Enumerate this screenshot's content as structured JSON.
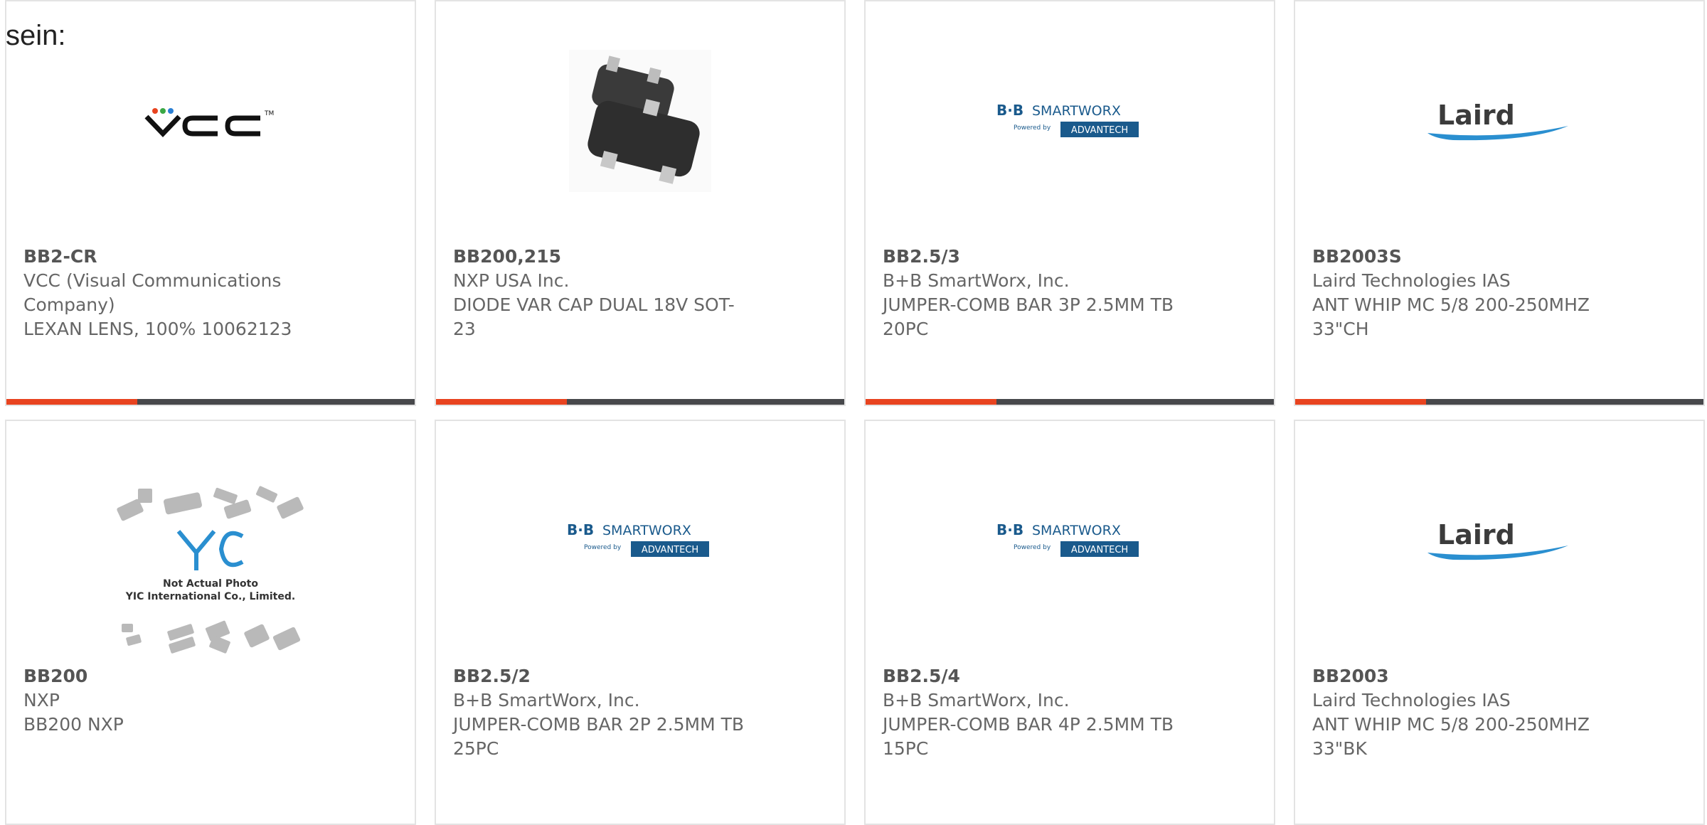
{
  "page": {
    "heading": "sein:"
  },
  "colors": {
    "accent": "#e8431f",
    "bar": "#47484b",
    "border": "#e3e3e3",
    "text": "#666666",
    "brand_blue": "#1a5a8c"
  },
  "products": [
    {
      "part": "BB2-CR",
      "maker": "VCC (Visual Communications Company)",
      "description": "LEXAN LENS, 100% 10062123",
      "logo": "vcc-logo",
      "logo_text": "VCC",
      "progress": 0.32
    },
    {
      "part": "BB200,215",
      "maker": "NXP USA Inc.",
      "description": "DIODE VAR CAP DUAL 18V SOT-23",
      "logo": "sot23-package-photo",
      "progress": 0.32
    },
    {
      "part": "BB2.5/3",
      "maker": "B+B SmartWorx, Inc.",
      "description": "JUMPER-COMB BAR 3P 2.5MM TB 20PC",
      "logo": "bb-smartworx-logo",
      "logo_text": "B+B SMARTWORX",
      "logo_subtext": "Powered by",
      "logo_badge": "ADVANTECH",
      "progress": 0.32
    },
    {
      "part": "BB2003S",
      "maker": "Laird Technologies IAS",
      "description": "ANT WHIP MC 5/8 200-250MHZ 33\"CH",
      "logo": "laird-logo",
      "logo_text": "Laird",
      "progress": 0.32
    },
    {
      "part": "BB200",
      "maker": "NXP",
      "description": "BB200 NXP",
      "logo": "yic-placeholder",
      "logo_text": "YIC",
      "logo_caption1": "Not Actual Photo",
      "logo_caption2": "YIC International Co., Limited.",
      "progress": null
    },
    {
      "part": "BB2.5/2",
      "maker": "B+B SmartWorx, Inc.",
      "description": "JUMPER-COMB BAR 2P 2.5MM TB 25PC",
      "logo": "bb-smartworx-logo",
      "logo_text": "B+B SMARTWORX",
      "logo_subtext": "Powered by",
      "logo_badge": "ADVANTECH",
      "progress": null
    },
    {
      "part": "BB2.5/4",
      "maker": "B+B SmartWorx, Inc.",
      "description": "JUMPER-COMB BAR 4P 2.5MM TB 15PC",
      "logo": "bb-smartworx-logo",
      "logo_text": "B+B SMARTWORX",
      "logo_subtext": "Powered by",
      "logo_badge": "ADVANTECH",
      "progress": null
    },
    {
      "part": "BB2003",
      "maker": "Laird Technologies IAS",
      "description": "ANT WHIP MC 5/8 200-250MHZ 33\"BK",
      "logo": "laird-logo",
      "logo_text": "Laird",
      "progress": null
    }
  ]
}
